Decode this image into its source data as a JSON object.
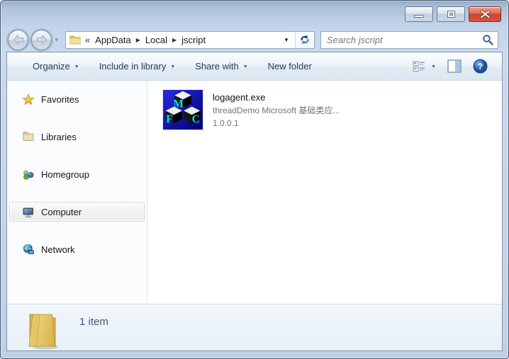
{
  "glyphs": {
    "dropdown": "▼",
    "overflow": "«",
    "crumb_sep": "▶",
    "help": "?"
  },
  "window": {
    "controls": [
      "minimize-icon",
      "maximize-icon",
      "close-icon"
    ]
  },
  "nav": {
    "back_disabled": true,
    "forward_disabled": true,
    "breadcrumb": {
      "segments": [
        "AppData",
        "Local",
        "jscript"
      ]
    },
    "search_placeholder": "Search jscript"
  },
  "toolbar": {
    "buttons": [
      {
        "label": "Organize",
        "has_dropdown": true
      },
      {
        "label": "Include in library",
        "has_dropdown": true
      },
      {
        "label": "Share with",
        "has_dropdown": true
      },
      {
        "label": "New folder",
        "has_dropdown": false
      }
    ],
    "view_controls": [
      "change-view-icon",
      "preview-pane-icon",
      "help-icon"
    ]
  },
  "sidebar": {
    "items": [
      {
        "label": "Favorites",
        "icon": "star-icon",
        "selected": false
      },
      {
        "label": "Libraries",
        "icon": "libraries-icon",
        "selected": false
      },
      {
        "label": "Homegroup",
        "icon": "homegroup-icon",
        "selected": false
      },
      {
        "label": "Computer",
        "icon": "computer-icon",
        "selected": true
      },
      {
        "label": "Network",
        "icon": "network-icon",
        "selected": false
      }
    ]
  },
  "content": {
    "files": [
      {
        "name": "logagent.exe",
        "description": "threadDemo Microsoft 基础类应...",
        "version": "1.0.0.1",
        "icon": "mfc-application-icon",
        "icon_letters": [
          "M",
          "F",
          "C"
        ]
      }
    ]
  },
  "statusbar": {
    "count_text": "1 item"
  },
  "colors": {
    "titlebar_blue": "#c3d5ea",
    "close_red": "#c94630",
    "toolbar_text": "#1e3c5a",
    "secondary_text": "#737373",
    "status_text": "#3a5a7c",
    "accent_blue": "#3a6ea5",
    "mfc_cyan": "#00e5e5",
    "folder_yellow": "#eccd6a"
  }
}
